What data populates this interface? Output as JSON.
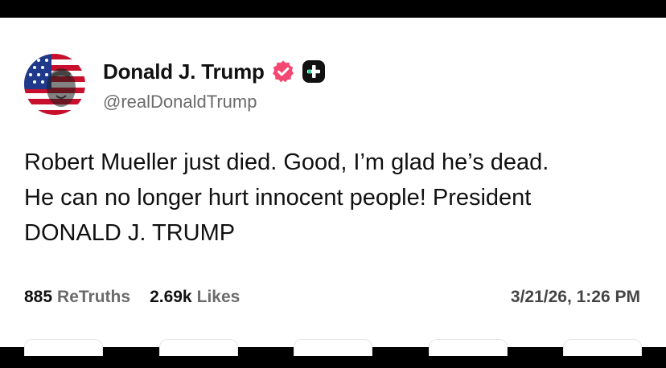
{
  "author": {
    "display_name": "Donald J. Trump",
    "handle": "@realDonaldTrump",
    "avatar_icon": "flag-portrait-avatar",
    "verified_icon": "verified-badge-icon",
    "plus_icon": "truth-plus-icon",
    "verified_color": "#f44772",
    "plus_color": "#111111"
  },
  "post": {
    "lines": [
      "Robert Mueller just died. Good, I’m glad he’s dead.",
      "He can no longer hurt innocent people! President",
      "DONALD J. TRUMP"
    ]
  },
  "stats": {
    "retruths_count": "885",
    "retruths_label": "ReTruths",
    "likes_count": "2.69k",
    "likes_label": "Likes",
    "timestamp": "3/21/26, 1:26 PM"
  },
  "colors": {
    "background": "#ffffff",
    "frame": "#000000",
    "text": "#111111",
    "muted": "#6b6b6b"
  }
}
